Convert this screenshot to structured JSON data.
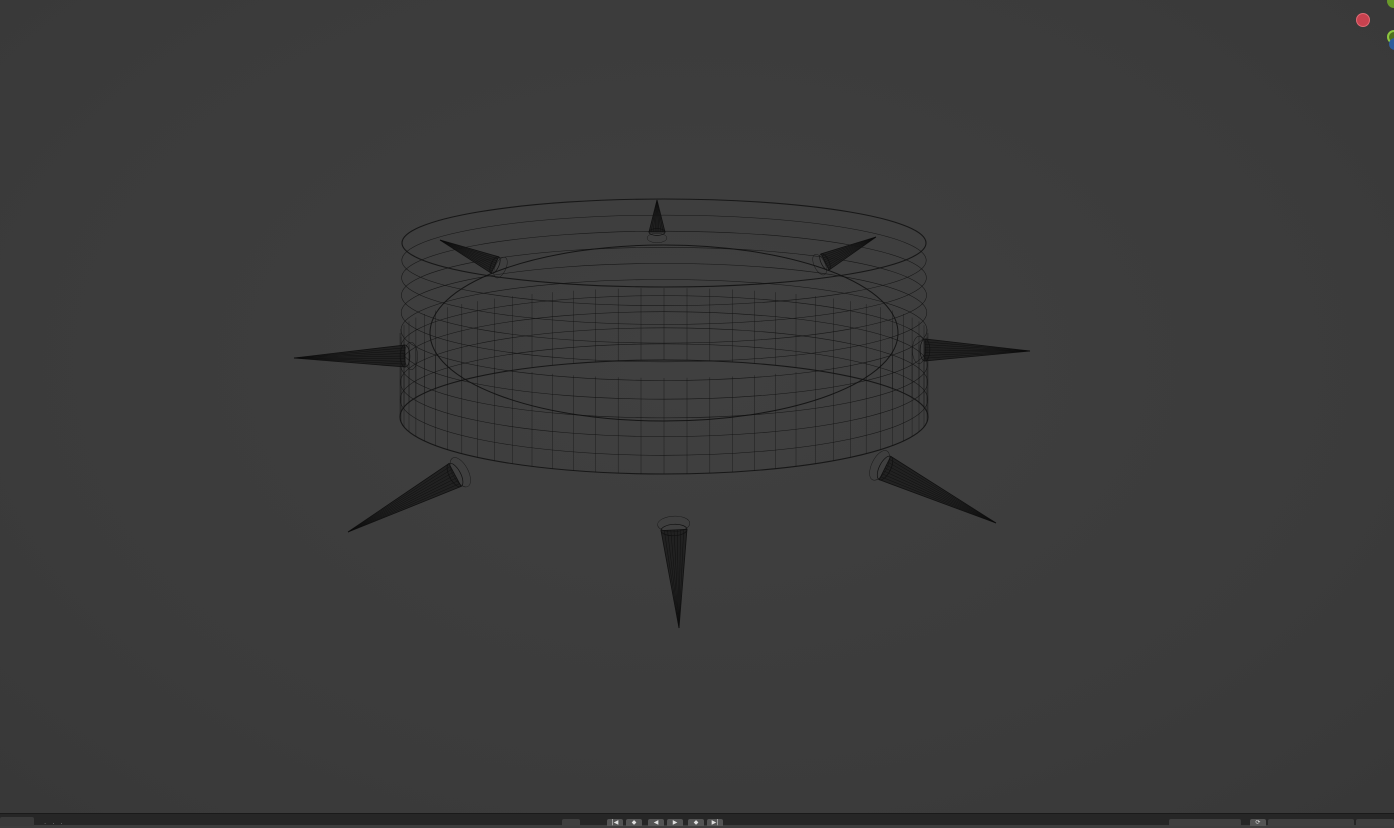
{
  "viewport": {
    "mode": "wireframe",
    "object": "spiked-collar",
    "spike_count": 8,
    "colors": {
      "background": "#3d3d3d",
      "wire": "#111111",
      "gizmo_x": "#c8424f",
      "gizmo_y": "#8dc63f",
      "gizmo_z": "#2d5c9c"
    }
  },
  "timeline": {
    "controls": [
      "jump-start-icon",
      "prev-keyframe-icon",
      "play-reverse-icon",
      "play-icon",
      "next-keyframe-icon",
      "jump-end-icon"
    ]
  }
}
